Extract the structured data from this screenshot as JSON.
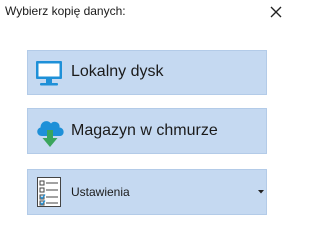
{
  "dialog": {
    "title": "Wybierz kopię danych:",
    "close_icon": "close-icon"
  },
  "options": [
    {
      "label": "Lokalny dysk",
      "icon": "monitor-icon",
      "color": "#1e90d8"
    },
    {
      "label": "Magazyn w chmurze",
      "icon": "cloud-download-icon",
      "color": "#3aa55d"
    },
    {
      "label": "Ustawienia",
      "icon": "checklist-icon",
      "has_dropdown": true
    }
  ],
  "colors": {
    "option_background": "#c5d9f1",
    "option_border": "#b3cbe8"
  }
}
